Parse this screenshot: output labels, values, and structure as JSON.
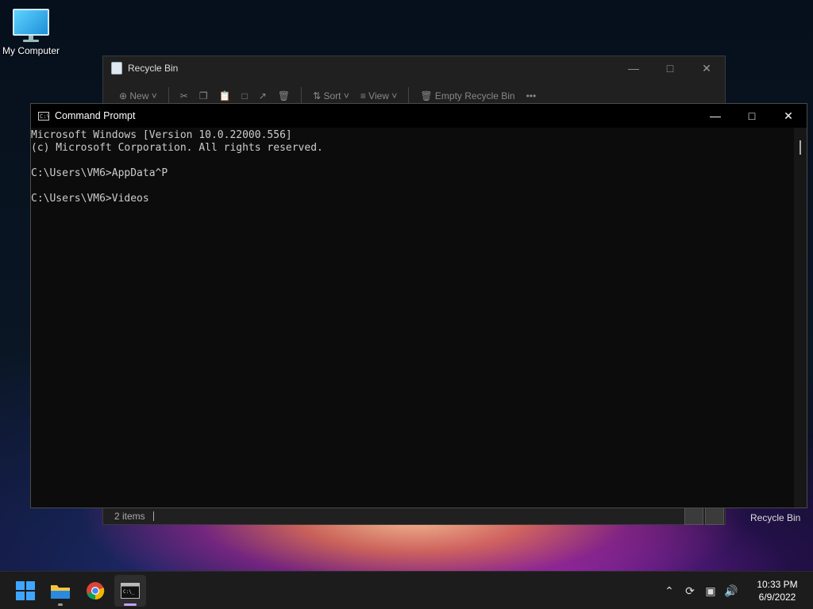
{
  "desktop": {
    "my_computer_label": "My Computer",
    "recycle_bin_label": "Recycle Bin"
  },
  "recycle_bin_window": {
    "title": "Recycle Bin",
    "toolbar": {
      "new_label": "New",
      "sort_label": "Sort",
      "view_label": "View",
      "empty_label": "Empty Recycle Bin",
      "more_label": "•••"
    },
    "status_count": "2 items"
  },
  "cmd_window": {
    "title": "Command Prompt",
    "lines": [
      "Microsoft Windows [Version 10.0.22000.556]",
      "(c) Microsoft Corporation. All rights reserved.",
      "",
      "C:\\Users\\VM6>AppData^P",
      "",
      "C:\\Users\\VM6>Videos"
    ]
  },
  "taskbar": {
    "time": "10:33 PM",
    "date": "6/9/2022",
    "items": [
      "start-icon",
      "file-explorer-icon",
      "chrome-icon",
      "command-prompt-icon"
    ],
    "accent_color": "#c7a0ff"
  }
}
